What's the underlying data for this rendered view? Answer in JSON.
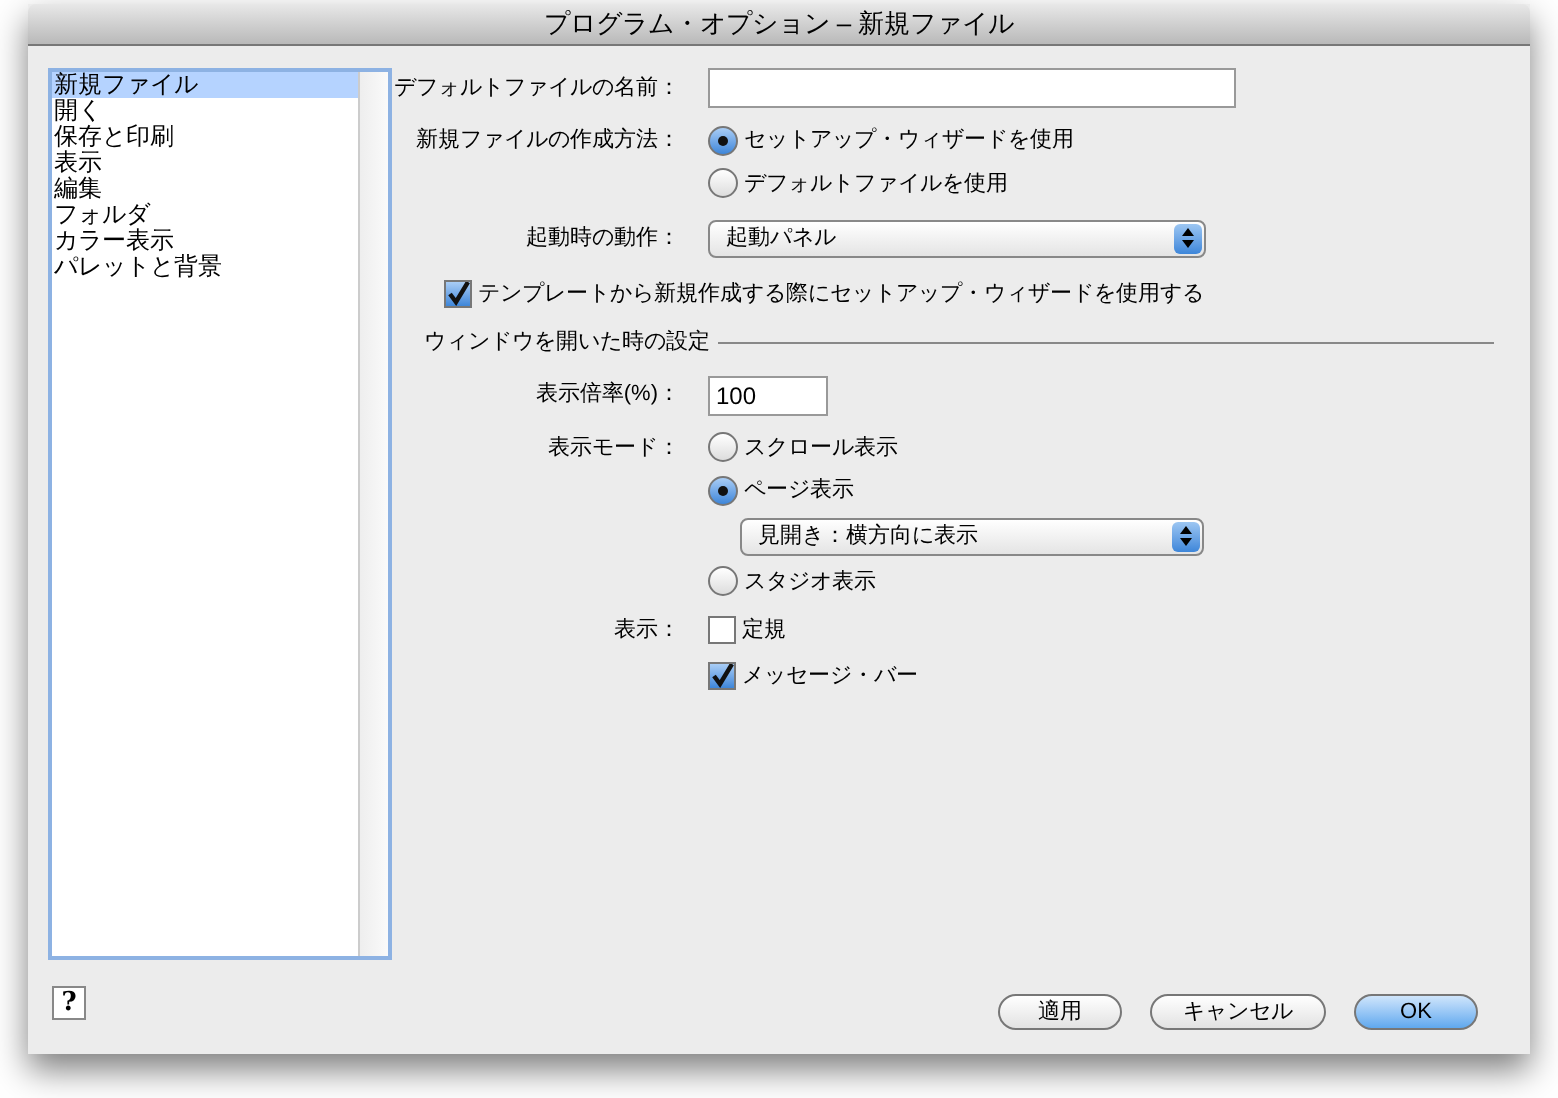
{
  "window": {
    "title": "プログラム・オプション – 新規ファイル"
  },
  "sidebar": {
    "items": [
      {
        "label": "新規ファイル",
        "selected": true
      },
      {
        "label": "開く",
        "selected": false
      },
      {
        "label": "保存と印刷",
        "selected": false
      },
      {
        "label": "表示",
        "selected": false
      },
      {
        "label": "編集",
        "selected": false
      },
      {
        "label": "フォルダ",
        "selected": false
      },
      {
        "label": "カラー表示",
        "selected": false
      },
      {
        "label": "パレットと背景",
        "selected": false
      }
    ]
  },
  "default_file_name": {
    "label": "デフォルトファイルの名前："
  },
  "creation_method": {
    "label": "新規ファイルの作成方法：",
    "options": [
      {
        "label": "セットアップ・ウィザードを使用",
        "selected": true
      },
      {
        "label": "デフォルトファイルを使用",
        "selected": false
      }
    ]
  },
  "startup_action": {
    "label": "起動時の動作：",
    "value": "起動パネル"
  },
  "template_wizard": {
    "label": "テンプレートから新規作成する際にセットアップ・ウィザードを使用する",
    "checked": true
  },
  "window_settings": {
    "title": "ウィンドウを開いた時の設定",
    "zoom": {
      "label": "表示倍率(%)：",
      "value": "100"
    },
    "display_mode": {
      "label": "表示モード：",
      "options": [
        {
          "label": "スクロール表示",
          "selected": false
        },
        {
          "label": "ページ表示",
          "selected": true
        },
        {
          "label": "スタジオ表示",
          "selected": false
        }
      ],
      "page_layout": "見開き：横方向に表示"
    },
    "show": {
      "label": "表示：",
      "items": [
        {
          "label": "定規",
          "checked": false
        },
        {
          "label": "メッセージ・バー",
          "checked": true
        }
      ]
    }
  },
  "help_button": "?",
  "buttons": [
    {
      "label": "適用",
      "default": false
    },
    {
      "label": "キャンセル",
      "default": false
    },
    {
      "label": "OK",
      "default": true
    }
  ]
}
